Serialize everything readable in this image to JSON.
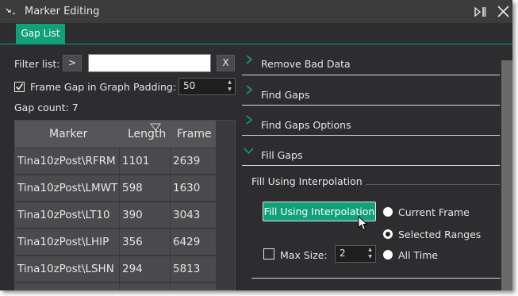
{
  "window": {
    "title": "Marker Editing"
  },
  "tabs": [
    {
      "label": "Gap List",
      "active": true
    }
  ],
  "filter": {
    "label": "Filter list:",
    "go_button": ">",
    "value": "",
    "clear_button": "X"
  },
  "frame_gap": {
    "label": "Frame Gap in Graph",
    "checked": true,
    "padding_label": "Padding:",
    "padding_value": "50"
  },
  "gap_count": "Gap count: 7",
  "table": {
    "columns": [
      "Marker",
      "Length",
      "Frame"
    ],
    "rows": [
      [
        "Tina10zPost\\RFRM",
        "1101",
        "2639"
      ],
      [
        "Tina10zPost\\LMWT",
        "598",
        "1630"
      ],
      [
        "Tina10zPost\\LT10",
        "390",
        "3043"
      ],
      [
        "Tina10zPost\\LHIP",
        "356",
        "6429"
      ],
      [
        "Tina10zPost\\LSHN",
        "294",
        "5813"
      ]
    ]
  },
  "sections": [
    {
      "label": "Remove Bad Data",
      "expanded": false
    },
    {
      "label": "Find Gaps",
      "expanded": false
    },
    {
      "label": "Find Gaps Options",
      "expanded": false
    },
    {
      "label": "Fill Gaps",
      "expanded": true
    }
  ],
  "fill": {
    "group_title": "Fill Using Interpolation",
    "button": "Fill Using Interpolation",
    "max_size_label": "Max Size:",
    "max_size_checked": false,
    "max_size_value": "2",
    "radios": [
      {
        "label": "Current Frame",
        "selected": false
      },
      {
        "label": "Selected Ranges",
        "selected": true
      },
      {
        "label": "All Time",
        "selected": false
      }
    ]
  },
  "colors": {
    "accent": "#11a07a",
    "background": "#2d2d30",
    "titlebar": "#3c3c3c"
  }
}
